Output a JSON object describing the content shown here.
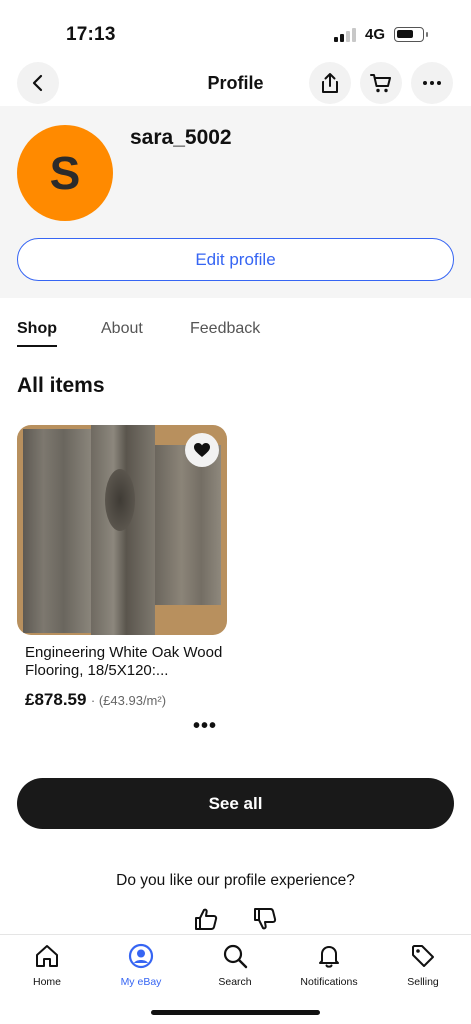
{
  "status_bar": {
    "time": "17:13",
    "network": "4G"
  },
  "nav": {
    "title": "Profile"
  },
  "profile": {
    "avatar_initial": "S",
    "username": "sara_5002",
    "edit_label": "Edit profile",
    "avatar_color": "#ff8a00"
  },
  "tabs": [
    {
      "label": "Shop",
      "active": true
    },
    {
      "label": "About",
      "active": false
    },
    {
      "label": "Feedback",
      "active": false
    }
  ],
  "section_title": "All items",
  "items": [
    {
      "title": "Engineering White Oak Wood Flooring, 18/5X120:...",
      "price": "£878.59",
      "unit_price": "· (£43.93/m²)",
      "more": "•••"
    }
  ],
  "see_all_label": "See all",
  "feedback_prompt": "Do you like our profile experience?",
  "bottom_nav": [
    {
      "label": "Home",
      "icon": "home-icon",
      "active": false
    },
    {
      "label": "My eBay",
      "icon": "user-icon",
      "active": true
    },
    {
      "label": "Search",
      "icon": "search-icon",
      "active": false
    },
    {
      "label": "Notifications",
      "icon": "bell-icon",
      "active": false
    },
    {
      "label": "Selling",
      "icon": "tag-icon",
      "active": false
    }
  ],
  "colors": {
    "accent": "#3665f3",
    "dark_button": "#191919",
    "panel_bg": "#f5f5f5"
  }
}
